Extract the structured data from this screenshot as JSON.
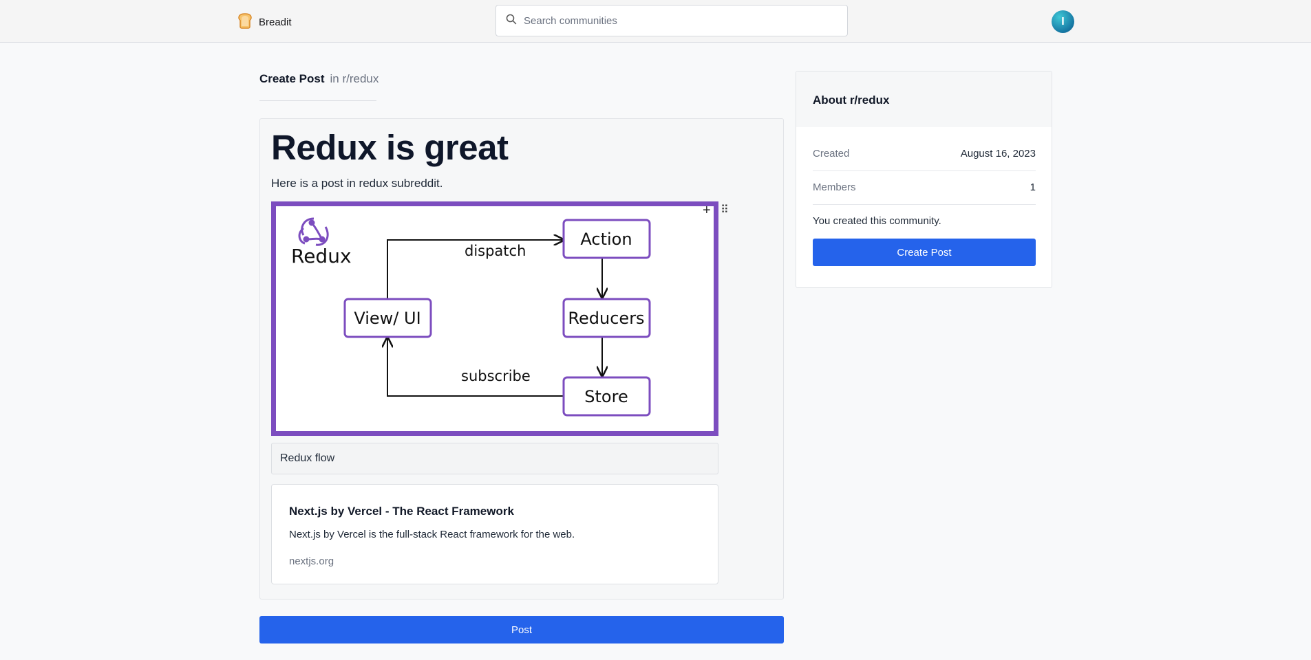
{
  "header": {
    "brand_name": "Breadit",
    "search_placeholder": "Search communities",
    "avatar_initial": "I"
  },
  "create": {
    "title": "Create Post",
    "subreddit": "in r/redux"
  },
  "editor": {
    "post_title": "Redux is great",
    "post_body": "Here is a post in redux subreddit.",
    "image": {
      "logo_text": "Redux",
      "nodes": {
        "action": "Action",
        "view": "View/ UI",
        "reducers": "Reducers",
        "store": "Store"
      },
      "edges": {
        "dispatch": "dispatch",
        "subscribe": "subscribe"
      }
    },
    "caption": "Redux flow",
    "link_preview": {
      "title": "Next.js by Vercel - The React Framework",
      "description": "Next.js by Vercel is the full-stack React framework for the web.",
      "url": "nextjs.org"
    },
    "post_button": "Post"
  },
  "sidebar": {
    "title": "About r/redux",
    "rows": [
      {
        "label": "Created",
        "value": "August 16, 2023"
      },
      {
        "label": "Members",
        "value": "1"
      }
    ],
    "note": "You created this community.",
    "button": "Create Post"
  },
  "colors": {
    "accent": "#2563eb",
    "redux_purple": "#7c4dbf"
  }
}
